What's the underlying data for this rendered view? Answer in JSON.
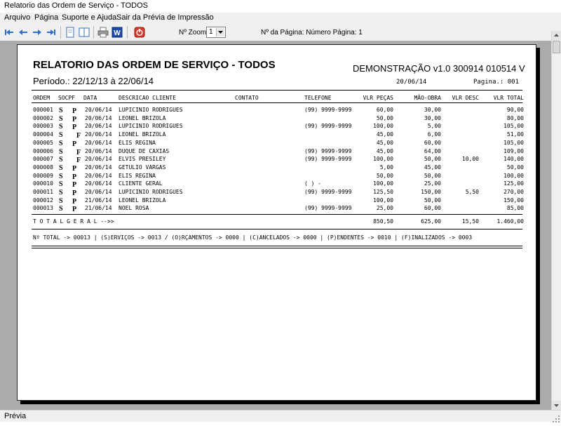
{
  "window": {
    "title": "Relatorio das Ordem de Serviço  - TODOS"
  },
  "menu": [
    {
      "label": "Arquivo"
    },
    {
      "label": "Página"
    },
    {
      "label": "Suporte e Ajuda"
    },
    {
      "label": "Sair da Prévia de Impressão"
    }
  ],
  "toolbar": {
    "zoom_label": "Nº Zoom",
    "zoom_value": "1",
    "page_info": "Nº da Página: Número Página: 1"
  },
  "report": {
    "title": "RELATORIO DAS ORDEM DE SERVIÇO  - TODOS",
    "demo": "DEMONSTRAÇÃO v1.0 300914 010514 V",
    "periodo": "Período.: 22/12/13 à 22/06/14",
    "print_date": "20/06/14",
    "page_label": "Pagina.: 001",
    "headers": [
      "ORDEM",
      "SOCPF",
      "DATA",
      "DESCRICAO CLIENTE",
      "CONTATO",
      "TELEFONE",
      "VLR PEÇAS",
      "MÃO-OBRA",
      "VLR DESC",
      "VLR TOTAL"
    ],
    "rows": [
      {
        "ordem": "000001",
        "s": "S",
        "st": "P",
        "data": "20/06/14",
        "cliente": "LUPICINIO RODRIGUES",
        "telefone": "(99) 9999-9999",
        "pecas": "60,00",
        "mao": "30,00",
        "desc": "",
        "total": "90,00"
      },
      {
        "ordem": "000002",
        "s": "S",
        "st": "P",
        "data": "20/06/14",
        "cliente": "LEONEL BRIZOLA",
        "telefone": "",
        "pecas": "50,00",
        "mao": "30,00",
        "desc": "",
        "total": "80,00"
      },
      {
        "ordem": "000003",
        "s": "S",
        "st": "P",
        "data": "20/06/14",
        "cliente": "LUPICINIO RODRIGUES",
        "telefone": "(99) 9999-9999",
        "pecas": "100,00",
        "mao": "5,00",
        "desc": "",
        "total": "105,00"
      },
      {
        "ordem": "000004",
        "s": "S",
        "st": "F",
        "data": "20/06/14",
        "cliente": "LEONEL BRIZOLA",
        "telefone": "",
        "pecas": "45,00",
        "mao": "6,00",
        "desc": "",
        "total": "51,00"
      },
      {
        "ordem": "000005",
        "s": "S",
        "st": "P",
        "data": "20/06/14",
        "cliente": "ELIS REGINA",
        "telefone": "",
        "pecas": "45,00",
        "mao": "60,00",
        "desc": "",
        "total": "105,00"
      },
      {
        "ordem": "000006",
        "s": "S",
        "st": "F",
        "data": "20/06/14",
        "cliente": "DUQUE DE CAXIAS",
        "telefone": "(99) 9999-9999",
        "pecas": "45,00",
        "mao": "64,00",
        "desc": "",
        "total": "109,00"
      },
      {
        "ordem": "000007",
        "s": "S",
        "st": "F",
        "data": "20/06/14",
        "cliente": "ELVIS PRESILEY",
        "telefone": "(99) 9999-9999",
        "pecas": "100,00",
        "mao": "50,00",
        "desc": "10,00",
        "total": "140,00"
      },
      {
        "ordem": "000008",
        "s": "S",
        "st": "P",
        "data": "20/06/14",
        "cliente": "GETULIO VARGAS",
        "telefone": "",
        "pecas": "5,00",
        "mao": "45,00",
        "desc": "",
        "total": "50,00"
      },
      {
        "ordem": "000009",
        "s": "S",
        "st": "P",
        "data": "20/06/14",
        "cliente": "ELIS REGINA",
        "telefone": "",
        "pecas": "50,00",
        "mao": "50,00",
        "desc": "",
        "total": "100,00"
      },
      {
        "ordem": "000010",
        "s": "S",
        "st": "P",
        "data": "20/06/14",
        "cliente": "CLIENTE GERAL",
        "telefone": "(  )    -",
        "pecas": "100,00",
        "mao": "25,00",
        "desc": "",
        "total": "125,00"
      },
      {
        "ordem": "000011",
        "s": "S",
        "st": "P",
        "data": "20/06/14",
        "cliente": "LUPICINIO RODRIGUES",
        "telefone": "(99) 9999-9999",
        "pecas": "125,50",
        "mao": "150,00",
        "desc": "5,50",
        "total": "270,00"
      },
      {
        "ordem": "000012",
        "s": "S",
        "st": "P",
        "data": "21/06/14",
        "cliente": "LEONEL BRIZOLA",
        "telefone": "",
        "pecas": "100,00",
        "mao": "50,00",
        "desc": "",
        "total": "150,00"
      },
      {
        "ordem": "000013",
        "s": "S",
        "st": "P",
        "data": "21/06/14",
        "cliente": "NOEL ROSA",
        "telefone": "(99) 9999-9999",
        "pecas": "25,00",
        "mao": "60,00",
        "desc": "",
        "total": "85,00"
      }
    ],
    "total_label": "T O T A L   G E R A L  -->>",
    "total": {
      "pecas": "850,50",
      "mao": "625,00",
      "desc": "15,50",
      "total": "1.460,00"
    },
    "summary": "Nº TOTAL -> 00013 | (S)ERVIÇOS -> 0013 / (O)RÇAMENTOS -> 0000 | (C)ANCELADOS -> 0000 | (P)ENDENTES -> 0010 | (F)INALIZADOS -> 0003"
  },
  "statusbar": {
    "text": "Prévia"
  }
}
